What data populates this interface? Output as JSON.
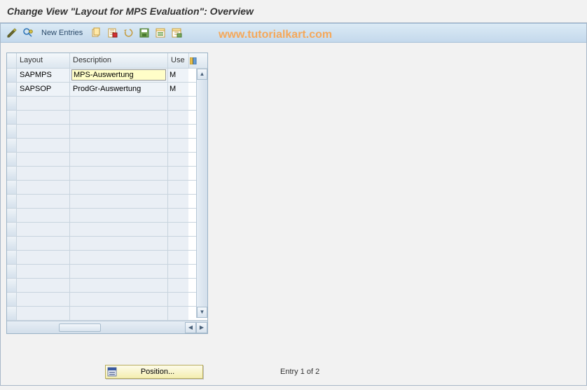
{
  "title": "Change View \"Layout for MPS Evaluation\": Overview",
  "watermark": "www.tutorialkart.com",
  "toolbar": {
    "new_entries_label": "New Entries"
  },
  "grid": {
    "columns": {
      "layout": "Layout",
      "description": "Description",
      "use": "Use"
    },
    "rows": [
      {
        "layout": "SAPMPS",
        "description": "MPS-Auswertung",
        "use": "M",
        "selected": true
      },
      {
        "layout": "SAPSOP",
        "description": "ProdGr-Auswertung",
        "use": "M",
        "selected": false
      }
    ],
    "empty_row_count": 16
  },
  "footer": {
    "position_label": "Position...",
    "entry_text": "Entry 1 of 2"
  }
}
